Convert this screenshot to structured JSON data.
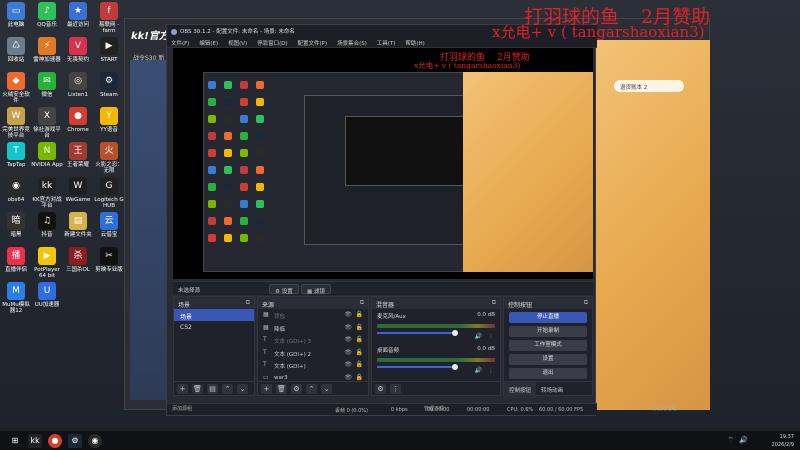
{
  "desktop": {
    "icons": [
      {
        "label": "此电脑",
        "glyph": "▭",
        "color": "#3a7bd5"
      },
      {
        "label": "QQ音乐",
        "glyph": "♪",
        "color": "#2fbf5b"
      },
      {
        "label": "最近访问",
        "glyph": "★",
        "color": "#3b6fd1"
      },
      {
        "label": "易联网 - farm",
        "glyph": "f",
        "color": "#c23b3b"
      },
      {
        "label": "回收站",
        "glyph": "♺",
        "color": "#6f7b88"
      },
      {
        "label": "雷神加速器",
        "glyph": "⚡",
        "color": "#e07b24"
      },
      {
        "label": "无畏契约",
        "glyph": "V",
        "color": "#d9304b"
      },
      {
        "label": "START",
        "glyph": "▶",
        "color": "#222"
      },
      {
        "label": "火绒安全软件",
        "glyph": "◆",
        "color": "#f06a2c"
      },
      {
        "label": "微信",
        "glyph": "✉",
        "color": "#27b33a"
      },
      {
        "label": "Listen1",
        "glyph": "◎",
        "color": "#444"
      },
      {
        "label": "Steam",
        "glyph": "⚙",
        "color": "#1b2838"
      },
      {
        "label": "完美世界竞技平台",
        "glyph": "W",
        "color": "#c9a14a"
      },
      {
        "label": "徐社游戏平台",
        "glyph": "X",
        "color": "#444"
      },
      {
        "label": "Chrome",
        "glyph": "●",
        "color": "#d33c2e"
      },
      {
        "label": "YY语音",
        "glyph": "Y",
        "color": "#f5b700"
      },
      {
        "label": "TapTap",
        "glyph": "T",
        "color": "#15c5ce"
      },
      {
        "label": "NVIDIA App",
        "glyph": "N",
        "color": "#76b900"
      },
      {
        "label": "王者荣耀",
        "glyph": "王",
        "color": "#a13b2f"
      },
      {
        "label": "火影之忍：无限",
        "glyph": "火",
        "color": "#b8502a"
      },
      {
        "label": "obs64",
        "glyph": "◉",
        "color": "#2a2a2a"
      },
      {
        "label": "KK官方对战平台",
        "glyph": "kk",
        "color": "#222"
      },
      {
        "label": "WeGame",
        "glyph": "W",
        "color": "#1f1f1f"
      },
      {
        "label": "Logitech G HUB",
        "glyph": "G",
        "color": "#222"
      },
      {
        "label": "暗黑",
        "glyph": "暗",
        "color": "#333"
      },
      {
        "label": "抖音",
        "glyph": "♫",
        "color": "#111"
      },
      {
        "label": "新建文件夹",
        "glyph": "▤",
        "color": "#d7b24a"
      },
      {
        "label": "云借宝",
        "glyph": "云",
        "color": "#2d6fd8"
      },
      {
        "label": "直播伴侣",
        "glyph": "播",
        "color": "#ee2e4a"
      },
      {
        "label": "PotPlayer 64 bit",
        "glyph": "▶",
        "color": "#f3c600"
      },
      {
        "label": "三国杀OL",
        "glyph": "杀",
        "color": "#8a1f1f"
      },
      {
        "label": "剪映专业版",
        "glyph": "✂",
        "color": "#111"
      },
      {
        "label": "MuMu模拟器12",
        "glyph": "M",
        "color": "#2b7de9"
      },
      {
        "label": "UU加速器",
        "glyph": "U",
        "color": "#2e6ee0"
      }
    ]
  },
  "bg_window": {
    "logo": "kk!官方对",
    "subtitle": "战令S30 新",
    "game_button": "退货账本 2"
  },
  "overlay": {
    "line1_title": "打羽球的鱼",
    "line1_right": "2月赞助",
    "line2": "x允电+ v ( tangarshaoxian3)",
    "small1_title": "打羽球的鱼",
    "small1_right": "2月赞助",
    "small2": "x允电+ v ( tangarshaoxian3)"
  },
  "obs": {
    "title": "OBS 30.1.2 - 配置文件: 未命名 - 场景: 未命名",
    "menu": [
      "文件(F)",
      "编辑(E)",
      "视图(V)",
      "停靠窗口(D)",
      "配置文件(P)",
      "场景集合(S)",
      "工具(T)",
      "帮助(H)"
    ],
    "source_bar": {
      "no_source": "未选择源",
      "properties": "设置",
      "filters": "滤镜"
    },
    "scenes": {
      "title": "场景",
      "items": [
        "场景",
        "CS2"
      ]
    },
    "sources": {
      "title": "来源",
      "items": [
        {
          "name": "背包",
          "dim": true,
          "icon": "▦"
        },
        {
          "name": "降临",
          "dim": false,
          "icon": "▦"
        },
        {
          "name": "文本 (GDI+) 3",
          "dim": true,
          "icon": "T"
        },
        {
          "name": "文本 (GDI+) 2",
          "dim": false,
          "icon": "T"
        },
        {
          "name": "文本 (GDI+)",
          "dim": false,
          "icon": "T"
        },
        {
          "name": "war3",
          "dim": false,
          "icon": "▭"
        }
      ]
    },
    "mixer": {
      "title": "混音器",
      "channels": [
        {
          "name": "麦克风/Aux",
          "db": "0.0 dB"
        },
        {
          "name": "桌面音频",
          "db": "0.0 dB"
        }
      ]
    },
    "controls": {
      "title": "控制按钮",
      "buttons": [
        "停止直播",
        "开始录制",
        "工作室模式",
        "设置",
        "退出"
      ],
      "tabs": [
        "控制按钮",
        "转场动画"
      ]
    },
    "status": {
      "frames": "丢帧 0 (0.0%)",
      "kbps": "0 kbps",
      "rec_time": "00:00:00",
      "stream_time": "00:00:00",
      "cpu": "CPU: 0.6%",
      "fps": "60.00 / 60.00 FPS",
      "left_label": "添加源组",
      "mid_label": "管理下载",
      "right_label": "好友与帮助"
    }
  },
  "taskbar": {
    "time": "19:37",
    "date": "2026/2/9"
  }
}
